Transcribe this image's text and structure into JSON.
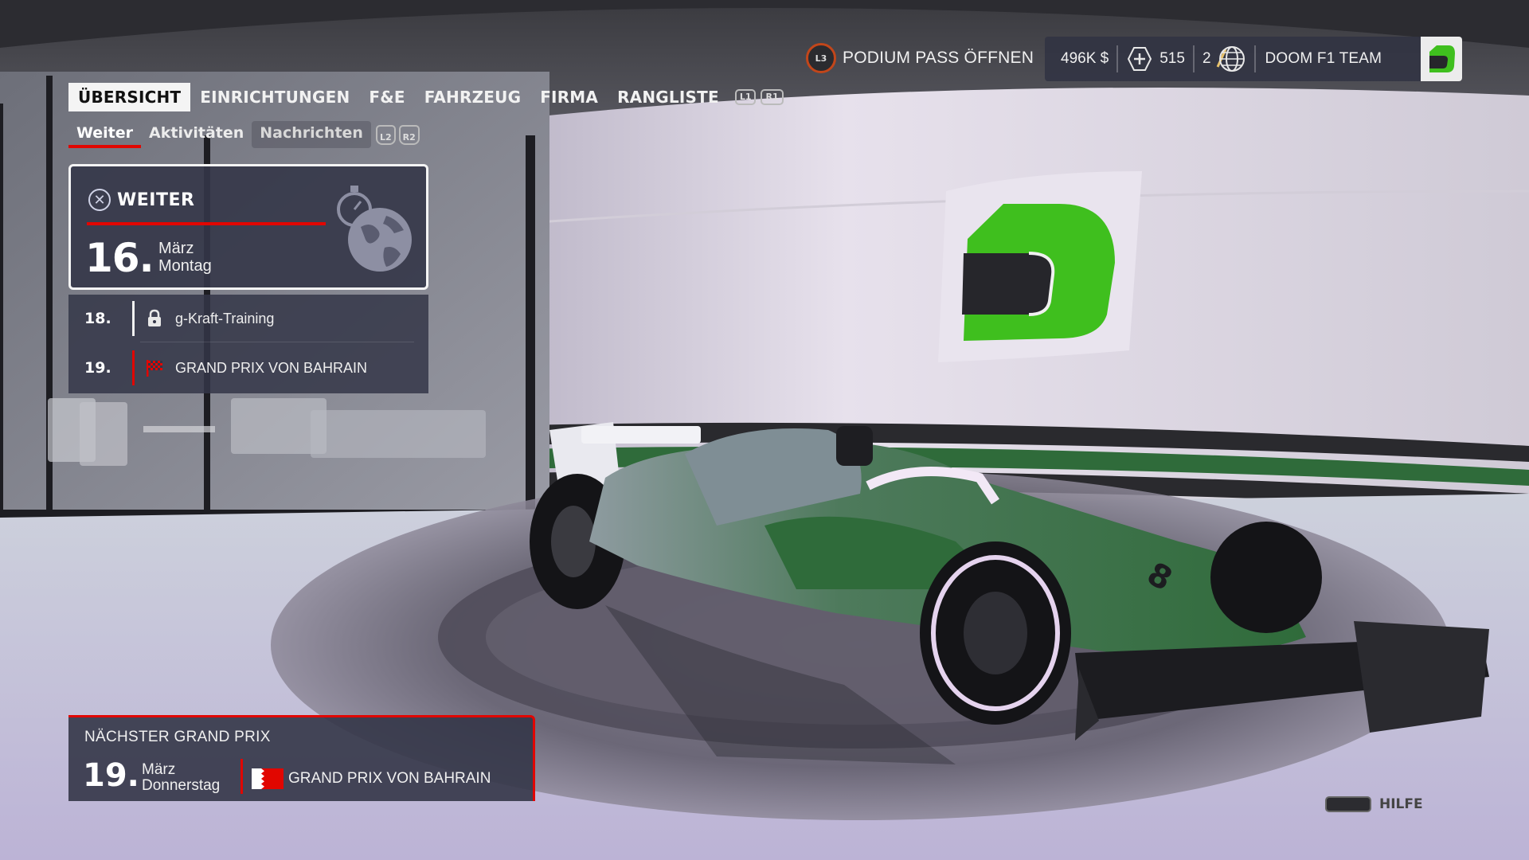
{
  "header": {
    "podium_button": "L3",
    "podium_label": "PODIUM PASS ÖFFNEN",
    "money": "496K $",
    "tokens": "515",
    "level": "2",
    "team_name": "DOOM F1 TEAM"
  },
  "nav": {
    "tabs": [
      {
        "label": "ÜBERSICHT",
        "active": true
      },
      {
        "label": "EINRICHTUNGEN"
      },
      {
        "label": "F&E"
      },
      {
        "label": "FAHRZEUG"
      },
      {
        "label": "FIRMA"
      },
      {
        "label": "RANGLISTE"
      }
    ],
    "shoulder_left": "L1",
    "shoulder_right": "R1"
  },
  "subnav": {
    "tabs": [
      {
        "label": "Weiter",
        "active": true
      },
      {
        "label": "Aktivitäten"
      },
      {
        "label": "Nachrichten"
      }
    ],
    "shoulder_left": "L2",
    "shoulder_right": "R2"
  },
  "weiter_card": {
    "title": "WEITER",
    "day": "16.",
    "month": "März",
    "weekday": "Montag"
  },
  "events": [
    {
      "day": "18.",
      "name": "g-Kraft-Training",
      "icon": "lock-icon"
    },
    {
      "day": "19.",
      "name": "GRAND PRIX VON BAHRAIN",
      "icon": "checkered-flag-icon"
    }
  ],
  "next_gp": {
    "caption": "NÄCHSTER GRAND PRIX",
    "day": "19.",
    "month": "März",
    "weekday": "Donnerstag",
    "name": "GRAND PRIX VON BAHRAIN"
  },
  "help": {
    "label": "HILFE"
  },
  "colors": {
    "accent_red": "#e10600",
    "team_green": "#3fbf1e",
    "car_green": "#2f6b3a",
    "panel": "#343648"
  }
}
